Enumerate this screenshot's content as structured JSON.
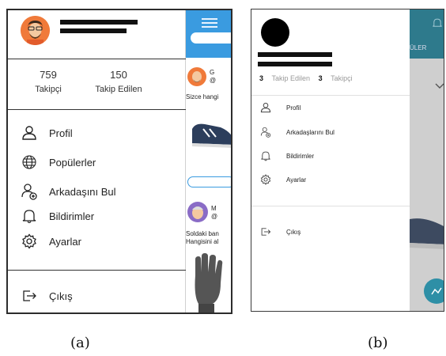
{
  "panel_a": {
    "stats": {
      "followers_count": "759",
      "followers_label": "Takipçi",
      "following_count": "150",
      "following_label": "Takip Edilen"
    },
    "menu": [
      {
        "label": "Profil",
        "icon": "person-icon"
      },
      {
        "label": "Popülerler",
        "icon": "globe-icon"
      },
      {
        "label": "Arkadaşını Bul",
        "icon": "add-person-icon"
      },
      {
        "label": "Bildirimler",
        "icon": "bell-icon"
      },
      {
        "label": "Ayarlar",
        "icon": "gear-icon"
      }
    ],
    "logout_label": "Çıkış",
    "feed": {
      "header_initial": "G",
      "header_at": "@",
      "prompt": "Sizce hangi",
      "header_initial_2": "M",
      "header_at_2": "@",
      "prompt_2_line1": "Soldaki ban",
      "prompt_2_line2": "Hangisini al"
    },
    "caption": "(a)"
  },
  "panel_b": {
    "stats": {
      "following_count": "3",
      "following_label": "Takip Edilen",
      "followers_count": "3",
      "followers_label": "Takipçi"
    },
    "menu": [
      {
        "label": "Profil",
        "icon": "person-icon"
      },
      {
        "label": "Arkadaşlarını Bul",
        "icon": "add-person-icon"
      },
      {
        "label": "Bildirimler",
        "icon": "bell-icon"
      },
      {
        "label": "Ayarlar",
        "icon": "gear-icon"
      }
    ],
    "logout_label": "Çıkış",
    "overlay_tab": "ÜLER",
    "caption": "(b)"
  },
  "colors": {
    "accent_a": "#3a9be0",
    "accent_b": "#2e7a8c",
    "avatar_a": "#f07a3a"
  }
}
